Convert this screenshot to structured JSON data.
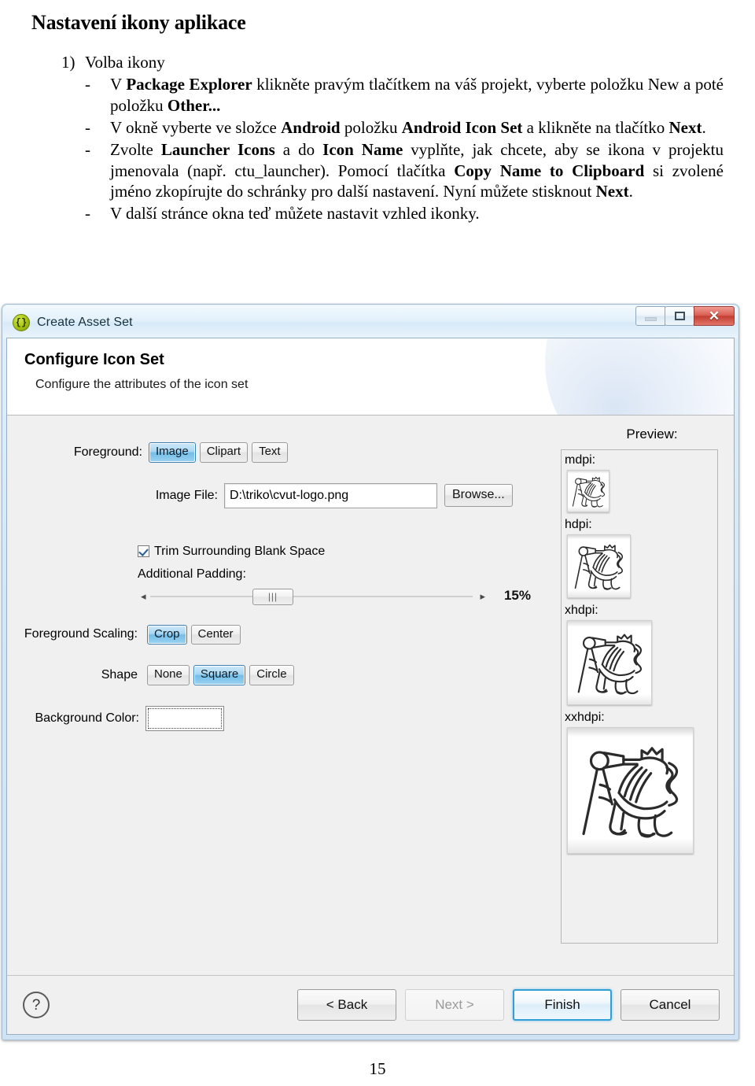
{
  "document": {
    "heading": "Nastavení ikony aplikace",
    "item_number": "1)",
    "item_title": "Volba ikony",
    "dash": "-",
    "bullets": [
      {
        "segments": [
          {
            "t": "V ",
            "b": false
          },
          {
            "t": "Package Explorer",
            "b": true
          },
          {
            "t": " klikněte pravým tlačítkem na váš projekt, vyberte položku New a poté položku ",
            "b": false
          },
          {
            "t": "Other...",
            "b": true
          }
        ]
      },
      {
        "segments": [
          {
            "t": "V okně vyberte ve složce ",
            "b": false
          },
          {
            "t": "Android",
            "b": true
          },
          {
            "t": " položku ",
            "b": false
          },
          {
            "t": "Android Icon Set",
            "b": true
          },
          {
            "t": " a klikněte na tlačítko ",
            "b": false
          },
          {
            "t": "Next",
            "b": true
          },
          {
            "t": ".",
            "b": false
          }
        ]
      },
      {
        "segments": [
          {
            "t": "Zvolte ",
            "b": false
          },
          {
            "t": "Launcher Icons",
            "b": true
          },
          {
            "t": " a do ",
            "b": false
          },
          {
            "t": "Icon Name",
            "b": true
          },
          {
            "t": " vyplňte, jak chcete, aby se ikona v projektu jmenovala (např. ctu_launcher). Pomocí tlačítka ",
            "b": false
          },
          {
            "t": "Copy Name to Clipboard",
            "b": true
          },
          {
            "t": " si zvolené jméno zkopírujte do schránky pro další nastavení. Nyní můžete stisknout ",
            "b": false
          },
          {
            "t": "Next",
            "b": true
          },
          {
            "t": ".",
            "b": false
          }
        ]
      },
      {
        "segments": [
          {
            "t": "V další stránce okna teď můžete nastavit vzhled ikonky.",
            "b": false
          }
        ]
      }
    ],
    "page_number": "15"
  },
  "dialog": {
    "titlebar": {
      "icon": "android-braces-icon",
      "title": "Create Asset Set",
      "minimize_label": "–",
      "maximize_label": "□",
      "close_label": "✕"
    },
    "header": {
      "title": "Configure Icon Set",
      "subtitle": "Configure the attributes of the icon set"
    },
    "form": {
      "foreground": {
        "label": "Foreground:",
        "options": [
          "Image",
          "Clipart",
          "Text"
        ],
        "selected": "Image"
      },
      "image_file": {
        "label": "Image File:",
        "value": "D:\\triko\\cvut-logo.png",
        "browse_label": "Browse..."
      },
      "trim": {
        "label": "Trim Surrounding Blank Space",
        "checked": true
      },
      "padding": {
        "label": "Additional Padding:",
        "value": "15%",
        "left_arrow": "◂",
        "right_arrow": "▸",
        "thumb_grip": "|||"
      },
      "foreground_scaling": {
        "label": "Foreground Scaling:",
        "options": [
          "Crop",
          "Center"
        ],
        "selected": "Crop"
      },
      "shape": {
        "label": "Shape",
        "options": [
          "None",
          "Square",
          "Circle"
        ],
        "selected": "Square"
      },
      "background_color": {
        "label": "Background Color:",
        "value": "#FFFFFF"
      }
    },
    "preview": {
      "title": "Preview:",
      "densities": [
        {
          "label": "mdpi:",
          "size": 48
        },
        {
          "label": "hdpi:",
          "size": 72
        },
        {
          "label": "xhdpi:",
          "size": 96
        },
        {
          "label": "xxhdpi:",
          "size": 144
        }
      ]
    },
    "buttonbar": {
      "help_label": "?",
      "back_label": "< Back",
      "next_label": "Next >",
      "finish_label": "Finish",
      "cancel_label": "Cancel",
      "next_disabled": true,
      "default_button": "Finish"
    },
    "colors": {
      "accent_selected": "#72bde8",
      "default_button_border": "#2f9fd8",
      "close_button": "#c33e31",
      "titlebar": "#dff0fb",
      "client_bg": "#f0f0f0"
    }
  }
}
